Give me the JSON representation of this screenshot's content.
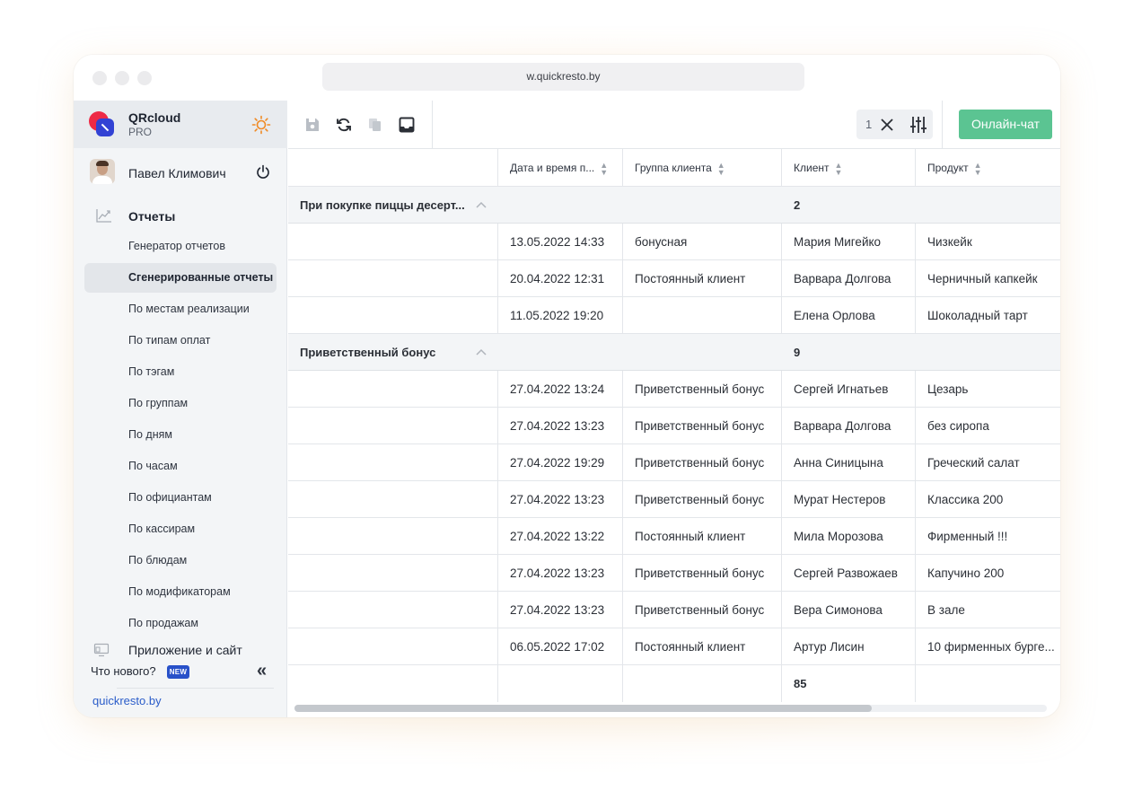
{
  "browser": {
    "url": "w.quickresto.by"
  },
  "brand": {
    "name": "QRcloud",
    "plan": "PRO"
  },
  "user": {
    "name": "Павел Климович"
  },
  "sidebar": {
    "section_label": "Отчеты",
    "items": [
      {
        "label": "Генератор отчетов"
      },
      {
        "label": "Сгенерированные отчеты",
        "active": true
      },
      {
        "label": "По местам реализации"
      },
      {
        "label": "По типам оплат"
      },
      {
        "label": "По тэгам"
      },
      {
        "label": "По группам"
      },
      {
        "label": "По дням"
      },
      {
        "label": "По часам"
      },
      {
        "label": "По официантам"
      },
      {
        "label": "По кассирам"
      },
      {
        "label": "По блюдам"
      },
      {
        "label": "По модификаторам"
      },
      {
        "label": "По продажам"
      }
    ],
    "app_link": "Приложение и сайт",
    "whats_new": "Что нового?",
    "new_badge": "NEW",
    "collapse_glyph": "«",
    "site_link": "quickresto.by"
  },
  "toolbar": {
    "filter_count": "1",
    "chat_button": "Онлайн-чат",
    "icons": [
      "save-icon",
      "refresh-icon",
      "copy-icon",
      "inbox-icon",
      "close-icon",
      "sliders-icon"
    ]
  },
  "table": {
    "columns": [
      "",
      "Дата и время п...",
      "Группа клиента",
      "Клиент",
      "Продукт"
    ],
    "groups": [
      {
        "name": "При покупке пиццы десерт...",
        "count": "2",
        "rows": [
          [
            "",
            "13.05.2022 14:33",
            "бонусная",
            "Мария Мигейко",
            "Чизкейк"
          ],
          [
            "",
            "20.04.2022 12:31",
            "Постоянный клиент",
            "Варвара Долгова",
            "Черничный капкейк"
          ],
          [
            "",
            "11.05.2022 19:20",
            "",
            "Елена Орлова",
            "Шоколадный тарт"
          ]
        ]
      },
      {
        "name": "Приветственный бонус",
        "count": "9",
        "rows": [
          [
            "",
            "27.04.2022 13:24",
            "Приветственный бонус",
            "Сергей Игнатьев",
            "Цезарь"
          ],
          [
            "",
            "27.04.2022 13:23",
            "Приветственный бонус",
            "Варвара Долгова",
            "без сиропа"
          ],
          [
            "",
            "27.04.2022 19:29",
            "Приветственный бонус",
            "Анна Синицына",
            "Греческий салат"
          ],
          [
            "",
            "27.04.2022 13:23",
            "Приветственный бонус",
            "Мурат Нестеров",
            "Классика 200"
          ],
          [
            "",
            "27.04.2022 13:22",
            "Постоянный клиент",
            "Мила Морозова",
            "Фирменный !!!"
          ],
          [
            "",
            "27.04.2022 13:23",
            "Приветственный бонус",
            "Сергей Развожаев",
            "Капучино 200"
          ],
          [
            "",
            "27.04.2022 13:23",
            "Приветственный бонус",
            "Вера Симонова",
            "В зале"
          ],
          [
            "",
            "06.05.2022 17:02",
            "Постоянный клиент",
            "Артур Лисин",
            "10 фирменных бурге..."
          ]
        ]
      }
    ],
    "total": "85"
  },
  "colors": {
    "accent_green": "#5bc492",
    "brand_red": "#ee2a46",
    "brand_blue": "#3242d4",
    "link_blue": "#2a5cc9",
    "badge_blue": "#2851c9"
  }
}
